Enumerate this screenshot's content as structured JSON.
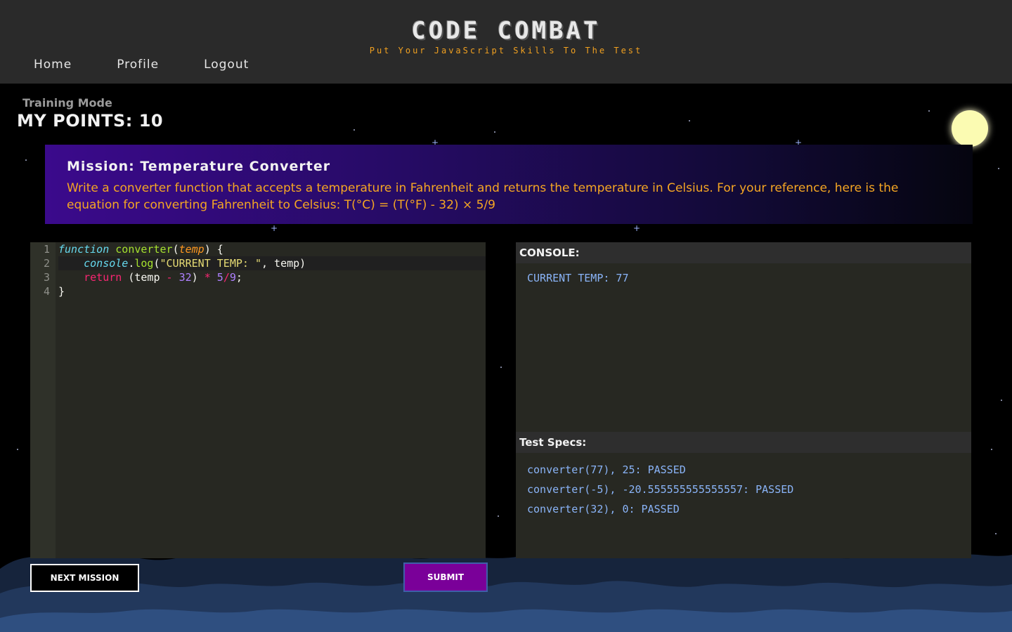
{
  "header": {
    "logo": "CODE COMBAT",
    "tagline": "Put Your JavaScript Skills To The Test",
    "nav": [
      "Home",
      "Profile",
      "Logout"
    ]
  },
  "status": {
    "mode": "Training Mode",
    "points": "MY POINTS: 10"
  },
  "mission": {
    "title": "Mission: Temperature Converter",
    "description": "Write a converter function that accepts a temperature in Fahrenheit and returns the temperature in Celsius. For your reference, here is the equation for converting Fahrenheit to Celsius: T(°C) = (T(°F) - 32) × 5/9"
  },
  "editor": {
    "line_numbers": [
      "1",
      "2",
      "3",
      "4"
    ],
    "lines": [
      "function converter(temp) {",
      "    console.log(\"CURRENT TEMP: \", temp)",
      "    return (temp - 32) * 5/9;",
      "}"
    ]
  },
  "console": {
    "heading": "CONSOLE:",
    "output": "CURRENT TEMP: 77"
  },
  "specs": {
    "heading": "Test Specs:",
    "items": [
      "converter(77), 25: PASSED",
      "converter(-5), -20.555555555555557: PASSED",
      "converter(32), 0: PASSED"
    ]
  },
  "buttons": {
    "next": "NEXT MISSION",
    "submit": "SUBMIT"
  },
  "colors": {
    "accent": "#f5a623",
    "submit": "#7a0099",
    "console_text": "#8ab4f8"
  }
}
